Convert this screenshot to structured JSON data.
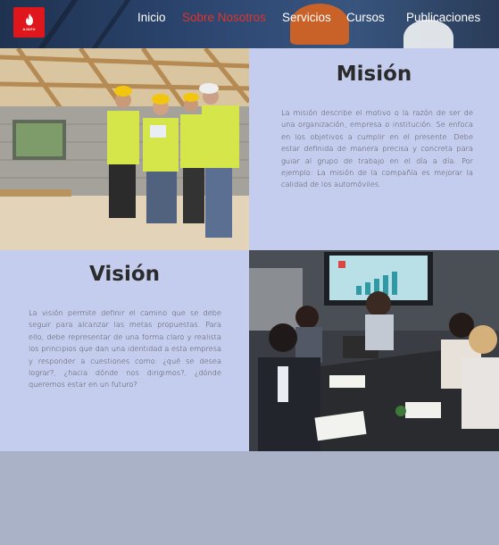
{
  "header": {
    "logo": {
      "text": "AJAYU",
      "icon": "flame-icon"
    },
    "nav": [
      {
        "label": "Inicio",
        "active": false
      },
      {
        "label": "Sobre Nosotros",
        "active": true
      },
      {
        "label": "Servicios",
        "active": false
      },
      {
        "label": "Cursos",
        "active": false
      },
      {
        "label": "Publicaciones",
        "active": false
      }
    ],
    "colors": {
      "active": "#e0332a",
      "logo_bg": "#e0161d",
      "panel_bg": "#c5cdee"
    }
  },
  "mision": {
    "title": "Misión",
    "text": "La misión describe el motivo o la razón de ser de una organización, empresa o institución. Se enfoca en los objetivos a cumplir en el presente. Debe estar definida de manera precisa y concreta para guiar al grupo de trabajo en el día a día. Por ejemplo: La misión de la compañía es mejorar la calidad de los automóviles."
  },
  "vision": {
    "title": "Visión",
    "text": "La visión permite definir el camino que se debe seguir para alcanzar las metas propuestas. Para ello, debe representar de una forma claro y realista los principios que dan una identidad a esta empresa y responder a cuestiones como: ¿qué se desea lograr?, ¿hacia dónde nos dirigimos?, ¿dónde queremos estar en un futuro?"
  }
}
